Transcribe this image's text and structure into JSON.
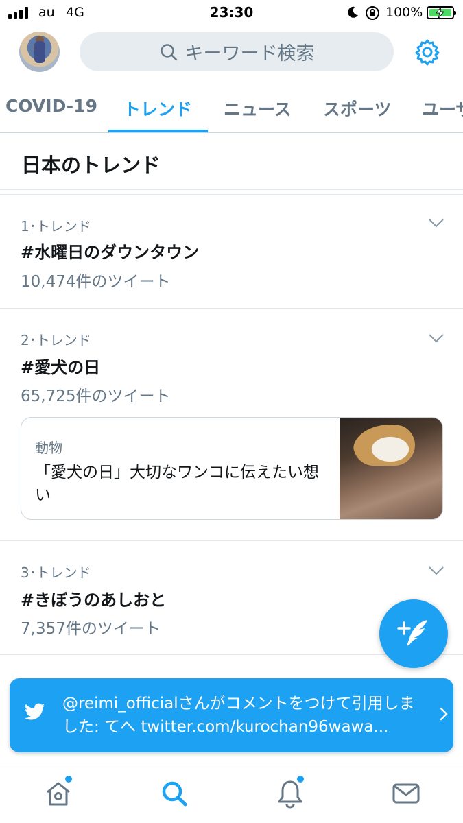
{
  "status_bar": {
    "carrier": "au",
    "network": "4G",
    "time": "23:30",
    "battery_percent": "100%",
    "battery_level": 1.0,
    "icons": [
      "signal-icon",
      "moon-icon",
      "orientation-lock-icon",
      "battery-charging-icon"
    ]
  },
  "header": {
    "search_placeholder": "キーワード検索",
    "icons": [
      "avatar",
      "search-icon",
      "gear-icon"
    ]
  },
  "tabs": [
    {
      "label": "COVID-19",
      "active": false
    },
    {
      "label": "トレンド",
      "active": true
    },
    {
      "label": "ニュース",
      "active": false
    },
    {
      "label": "スポーツ",
      "active": false
    },
    {
      "label": "ユーザ",
      "active": false
    }
  ],
  "section": {
    "title": "日本のトレンド"
  },
  "trends": [
    {
      "meta": "1･トレンド",
      "name": "#水曜日のダウンタウン",
      "count": "10,474件のツイート"
    },
    {
      "meta": "2･トレンド",
      "name": "#愛犬の日",
      "count": "65,725件のツイート"
    },
    {
      "meta": "3･トレンド",
      "name": "#きぼうのあしおと",
      "count": "7,357件のツイート"
    }
  ],
  "news_card": {
    "category": "動物",
    "headline": "「愛犬の日」大切なワンコに伝えたい想い"
  },
  "toast": {
    "message": "@reimi_officialさんがコメントをつけて引用しました: てへ twitter.com/kurochan96wawa..."
  },
  "bottom_nav": {
    "items": [
      "home-icon",
      "search-icon",
      "notifications-icon",
      "messages-icon"
    ]
  },
  "colors": {
    "accent": "#1da1f2",
    "text_primary": "#14171a",
    "text_secondary": "#657786",
    "search_bg": "#e6ecf0"
  }
}
